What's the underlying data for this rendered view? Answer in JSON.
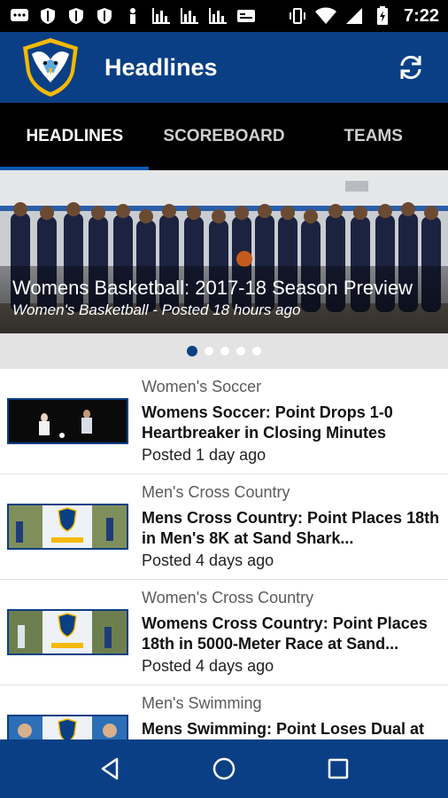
{
  "status_bar": {
    "time": "7:22"
  },
  "app_bar": {
    "title": "Headlines"
  },
  "tabs": [
    {
      "label": "HEADLINES",
      "active": true
    },
    {
      "label": "SCOREBOARD",
      "active": false
    },
    {
      "label": "TEAMS",
      "active": false
    }
  ],
  "featured": {
    "title": "Womens Basketball: 2017-18 Season Preview",
    "subtitle": "Women's Basketball - Posted 18 hours ago",
    "page_count": 5,
    "active_page": 1
  },
  "articles": [
    {
      "category": "Women's Soccer",
      "title": "Womens Soccer: Point Drops 1-0 Heartbreaker in Closing Minutes",
      "date": "Posted 1 day ago"
    },
    {
      "category": "Men's Cross Country",
      "title": "Mens Cross Country: Point Places 18th in Men's 8K at Sand Shark...",
      "date": "Posted 4 days ago"
    },
    {
      "category": "Women's Cross Country",
      "title": "Womens Cross Country: Point Places 18th in 5000-Meter Race at Sand...",
      "date": "Posted 4 days ago"
    },
    {
      "category": "Men's Swimming",
      "title": "Mens Swimming: Point Loses Dual at",
      "date": ""
    }
  ],
  "colors": {
    "primary": "#0b3f85",
    "accent": "#0b58b0",
    "tab_bg": "#000000"
  }
}
